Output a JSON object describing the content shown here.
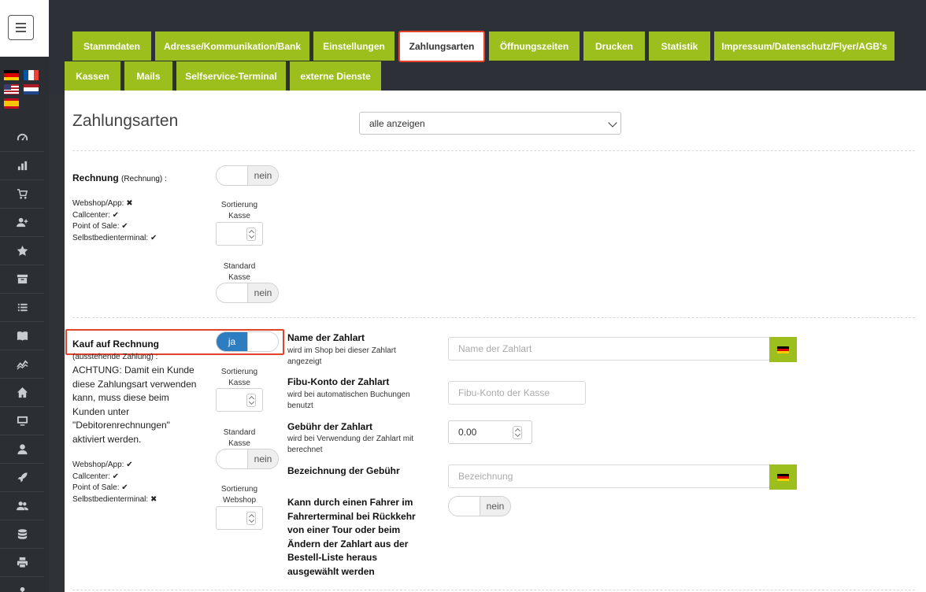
{
  "tabs": [
    {
      "label": "Stammdaten"
    },
    {
      "label": "Adresse/Kommunikation/Bank"
    },
    {
      "label": "Einstellungen"
    },
    {
      "label": "Zahlungsarten"
    },
    {
      "label": "Öffnungszeiten"
    },
    {
      "label": "Drucken"
    },
    {
      "label": "Statistik"
    },
    {
      "label": "Impressum/Datenschutz/Flyer/AGB's"
    },
    {
      "label": "Kassen"
    },
    {
      "label": "Mails"
    },
    {
      "label": "Selfservice-Terminal"
    },
    {
      "label": "externe Dienste"
    }
  ],
  "active_tab": "Zahlungsarten",
  "page": {
    "title": "Zahlungsarten",
    "filter_value": "alle anzeigen"
  },
  "rechnung": {
    "name": "Rechnung",
    "sub": "(Rechnung) :",
    "toggle": "nein",
    "channels": [
      "Webshop/App:",
      "Callcenter:",
      "Point of Sale:",
      "Selbstbedienterminal:"
    ],
    "channel_state": [
      "x",
      "check",
      "check",
      "check"
    ],
    "sort_label_1": "Sortierung",
    "sort_label_2": "Kasse",
    "std_label_1": "Standard",
    "std_label_2": "Kasse",
    "std_toggle": "nein"
  },
  "kauf": {
    "name": "Kauf auf Rechnung",
    "sub": "(ausstehende Zahlung) :",
    "note": "ACHTUNG: Damit ein Kunde diese Zahlungsart verwenden kann, muss diese beim Kunden unter \"Debitorenrechnungen\" aktiviert werden.",
    "toggle": "ja",
    "channels": [
      "Webshop/App:",
      "Callcenter:",
      "Point of Sale:",
      "Selbstbedienterminal:"
    ],
    "channel_state": [
      "check",
      "check",
      "check",
      "x"
    ],
    "sort_label_1": "Sortierung",
    "sort_label_2": "Kasse",
    "std_label_1": "Standard",
    "std_label_2": "Kasse",
    "std_toggle": "nein",
    "sortws_label_1": "Sortierung",
    "sortws_label_2": "Webshop",
    "fields": {
      "name_title": "Name der Zahlart",
      "name_sub": "wird im Shop bei dieser Zahlart angezeigt",
      "name_placeholder": "Name der Zahlart",
      "fibu_title": "Fibu-Konto der Zahlart",
      "fibu_sub": "wird bei automatischen Buchungen benutzt",
      "fibu_placeholder": "Fibu-Konto der Kasse",
      "fee_title": "Gebühr der Zahlart",
      "fee_sub": "wird bei Verwendung der Zahlart mit berechnet",
      "fee_value": "0.00",
      "feename_title": "Bezeichnung der Gebühr",
      "feename_placeholder": "Bezeichnung",
      "driver_title": "Kann durch einen Fahrer im Fahrerterminal bei Rückkehr von einer Tour oder beim Ändern der Zahlart aus der Bestell-Liste heraus ausgewählt werden",
      "driver_toggle": "nein"
    }
  },
  "icons": {
    "sidebar": [
      "gauge-icon",
      "bar-chart-icon",
      "cart-icon",
      "user-plus-icon",
      "star-icon",
      "archive-icon",
      "list-icon",
      "book-icon",
      "line-chart-icon",
      "home-icon",
      "monitor-icon",
      "user-icon",
      "rocket-icon",
      "users-icon",
      "database-icon",
      "printer-icon",
      "pin-icon"
    ]
  },
  "colors": {
    "accent_green": "#9dbf1e",
    "active_border": "#e2442a",
    "toggle_on": "#2f7dc1",
    "sidebar_bg": "#2b2f33"
  }
}
